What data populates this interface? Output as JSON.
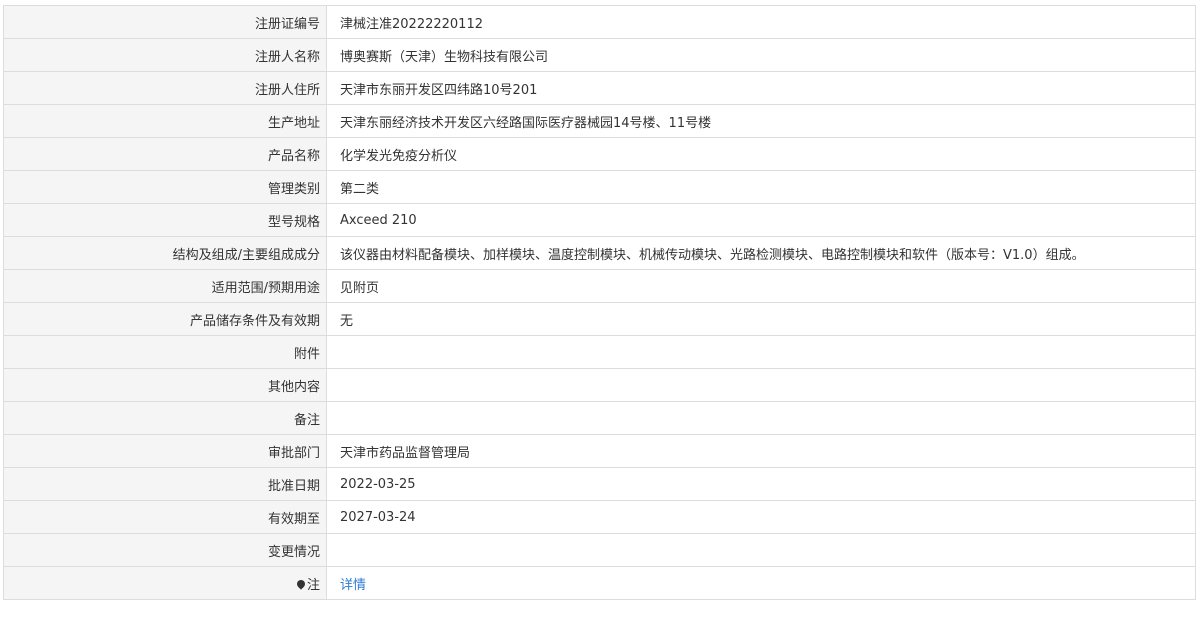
{
  "rows": [
    {
      "label": "注册证编号",
      "value": "津械注准20222220112"
    },
    {
      "label": "注册人名称",
      "value": "博奥赛斯（天津）生物科技有限公司"
    },
    {
      "label": "注册人住所",
      "value": "天津市东丽开发区四纬路10号201"
    },
    {
      "label": "生产地址",
      "value": "天津东丽经济技术开发区六经路国际医疗器械园14号楼、11号楼"
    },
    {
      "label": "产品名称",
      "value": "化学发光免疫分析仪"
    },
    {
      "label": "管理类别",
      "value": "第二类"
    },
    {
      "label": "型号规格",
      "value": "Axceed 210"
    },
    {
      "label": "结构及组成/主要组成成分",
      "value": "该仪器由材料配备模块、加样模块、温度控制模块、机械传动模块、光路检测模块、电路控制模块和软件（版本号：V1.0）组成。"
    },
    {
      "label": "适用范围/预期用途",
      "value": "见附页"
    },
    {
      "label": "产品储存条件及有效期",
      "value": "无"
    },
    {
      "label": "附件",
      "value": ""
    },
    {
      "label": "其他内容",
      "value": ""
    },
    {
      "label": "备注",
      "value": ""
    },
    {
      "label": "审批部门",
      "value": "天津市药品监督管理局"
    },
    {
      "label": "批准日期",
      "value": "2022-03-25"
    },
    {
      "label": "有效期至",
      "value": "2027-03-24"
    },
    {
      "label": "变更情况",
      "value": ""
    }
  ],
  "note_row": {
    "label": "注",
    "icon": "pin-icon",
    "link": "详情"
  },
  "colors": {
    "label_bg": "#f5f5f5",
    "border": "#dcdcdc",
    "text": "#333333",
    "link": "#2f7bd6"
  }
}
